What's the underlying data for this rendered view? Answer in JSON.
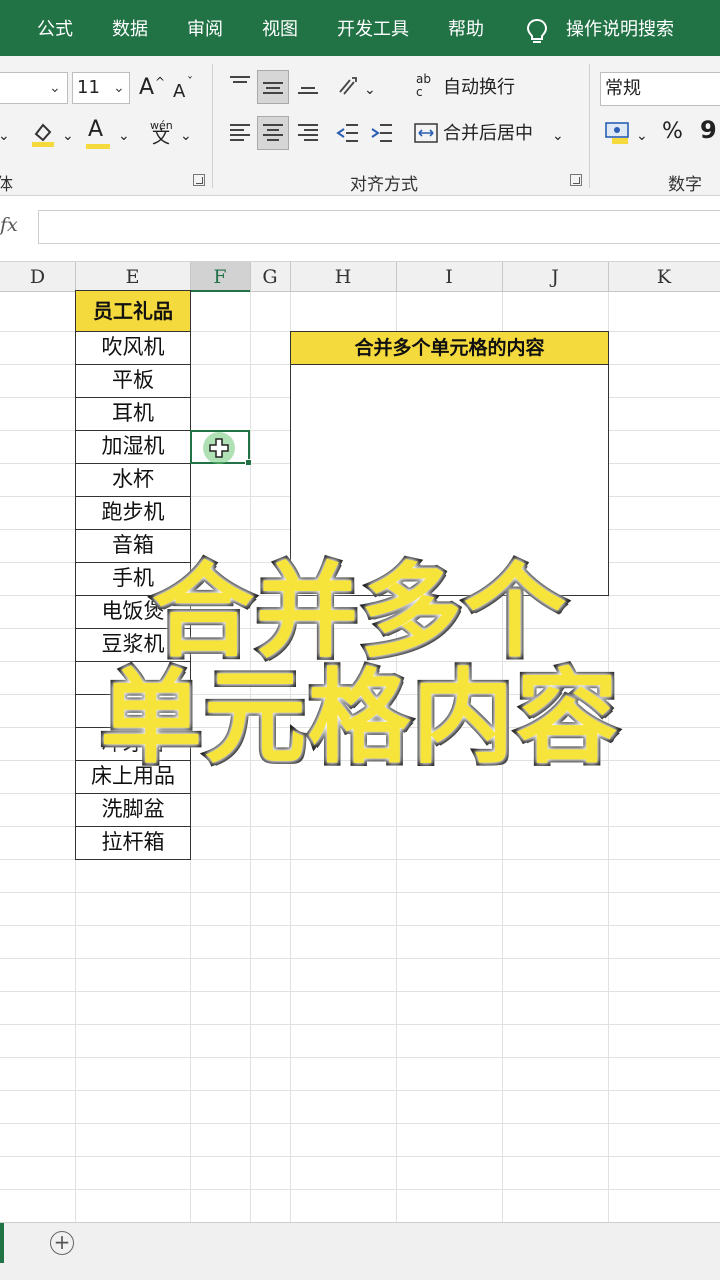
{
  "menubar": {
    "items": [
      "公式",
      "数据",
      "审阅",
      "视图",
      "开发工具",
      "帮助"
    ],
    "tell_me": "操作说明搜索"
  },
  "ribbon": {
    "font_size": "11",
    "grow_font": "A",
    "shrink_font": "A",
    "font_color_glyph": "A",
    "phonetic_glyph": "wén",
    "phonetic_glyph2": "文",
    "wrap_text": "自动换行",
    "wrap_icon_top": "ab",
    "wrap_icon_bottom": "c",
    "merge_center": "合并后居中",
    "number_format": "常规",
    "percent": "%",
    "comma": "9",
    "font_group_label": "体",
    "alignment_group_label": "对齐方式",
    "number_group_label": "数字"
  },
  "formula_bar": {
    "fx": "fx",
    "value": ""
  },
  "columns": [
    "D",
    "E",
    "F",
    "G",
    "H",
    "I",
    "J",
    "K"
  ],
  "sheet": {
    "header": "员工礼品",
    "items": [
      "吹风机",
      "平板",
      "耳机",
      "加湿机",
      "水杯",
      "跑步机",
      "音箱",
      "手机",
      "电饭煲",
      "豆浆机",
      "",
      "",
      "冲牙器",
      "床上用品",
      "洗脚盆",
      "拉杆箱"
    ],
    "merged_title": "合并多个单元格的内容"
  },
  "overlay": {
    "line1": "合并多个",
    "line2": "单元格内容"
  },
  "tabbar": {
    "add_sheet": "+"
  },
  "colors": {
    "excel_green": "#217346",
    "header_yellow": "#f5da3e",
    "overlay_yellow": "#f7e43a"
  }
}
